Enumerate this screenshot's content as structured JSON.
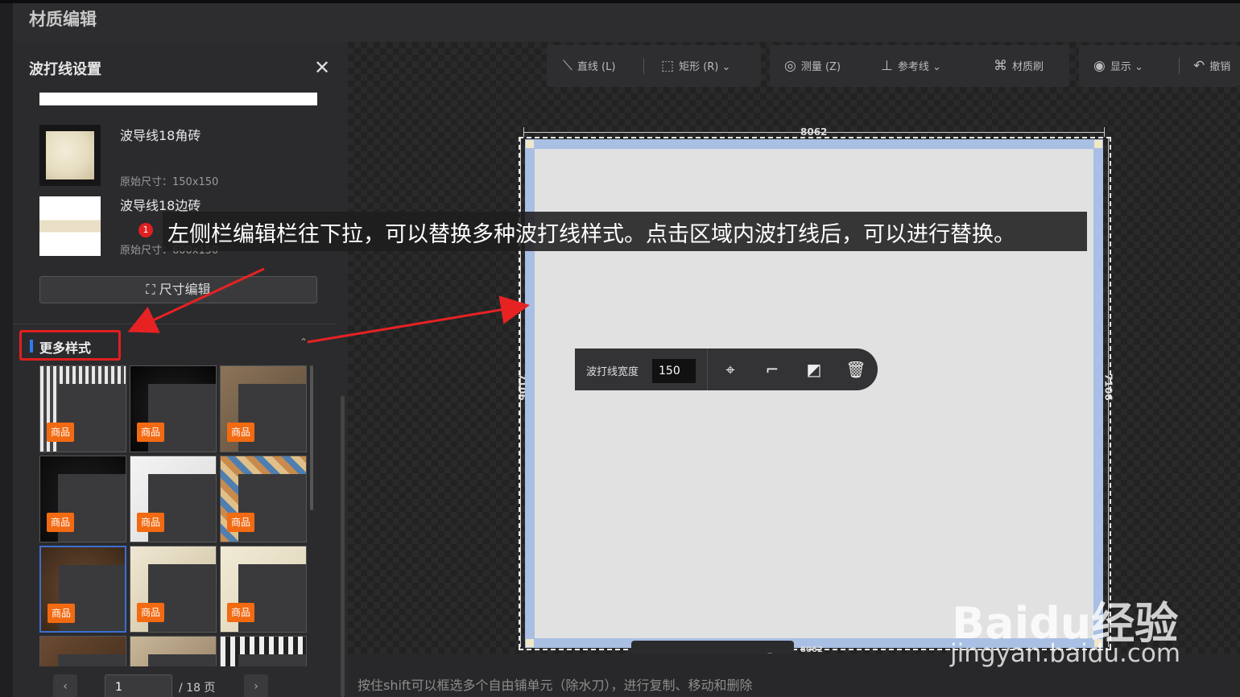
{
  "app": {
    "title": "材质编辑"
  },
  "panel": {
    "title": "波打线设置",
    "close_icon": "close-icon",
    "tiles": [
      {
        "name": "波导线18角砖",
        "size": "原始尺寸：150x150"
      },
      {
        "name": "波导线18边砖",
        "size": "原始尺寸：600x150"
      }
    ],
    "size_edit_label": "尺寸编辑",
    "more_styles_label": "更多样式",
    "badge": "商品",
    "grid_count": 12,
    "pager": {
      "current": "1",
      "total": "/ 18 页"
    }
  },
  "toolbar": {
    "line": "直线 (L)",
    "rect": "矩形 (R)",
    "measure": "测量 (Z)",
    "guide": "参考线",
    "brush": "材质刷",
    "display": "显示",
    "undo": "撤销"
  },
  "room": {
    "dim_top": "8062",
    "dim_left": "7106",
    "dim_right": "7106",
    "dim_bottom": "8062"
  },
  "float_toolbar": {
    "label": "波打线宽度",
    "value": "150",
    "icons": [
      "locate-icon",
      "add-corner-icon",
      "swap-pattern-icon",
      "delete-icon"
    ]
  },
  "zoom": {
    "icons": [
      "zoom-in-icon",
      "zoom-out-icon",
      "fullscreen-icon"
    ]
  },
  "status": {
    "hint": "按住shift可以框选多个自由铺单元（除水刀），进行复制、移动和删除"
  },
  "annotation": {
    "step": "1",
    "text": "左侧栏编辑栏往下拉，可以替换多种波打线样式。点击区域内波打线后，可以进行替换。"
  },
  "watermark": {
    "brand": "Baidu经验",
    "url": "jingyan.baidu.com"
  },
  "colors": {
    "accent": "#2d7bf0",
    "badge": "#f26a12",
    "highlight": "#e0201f",
    "border_tile": "#a9bfe3"
  }
}
